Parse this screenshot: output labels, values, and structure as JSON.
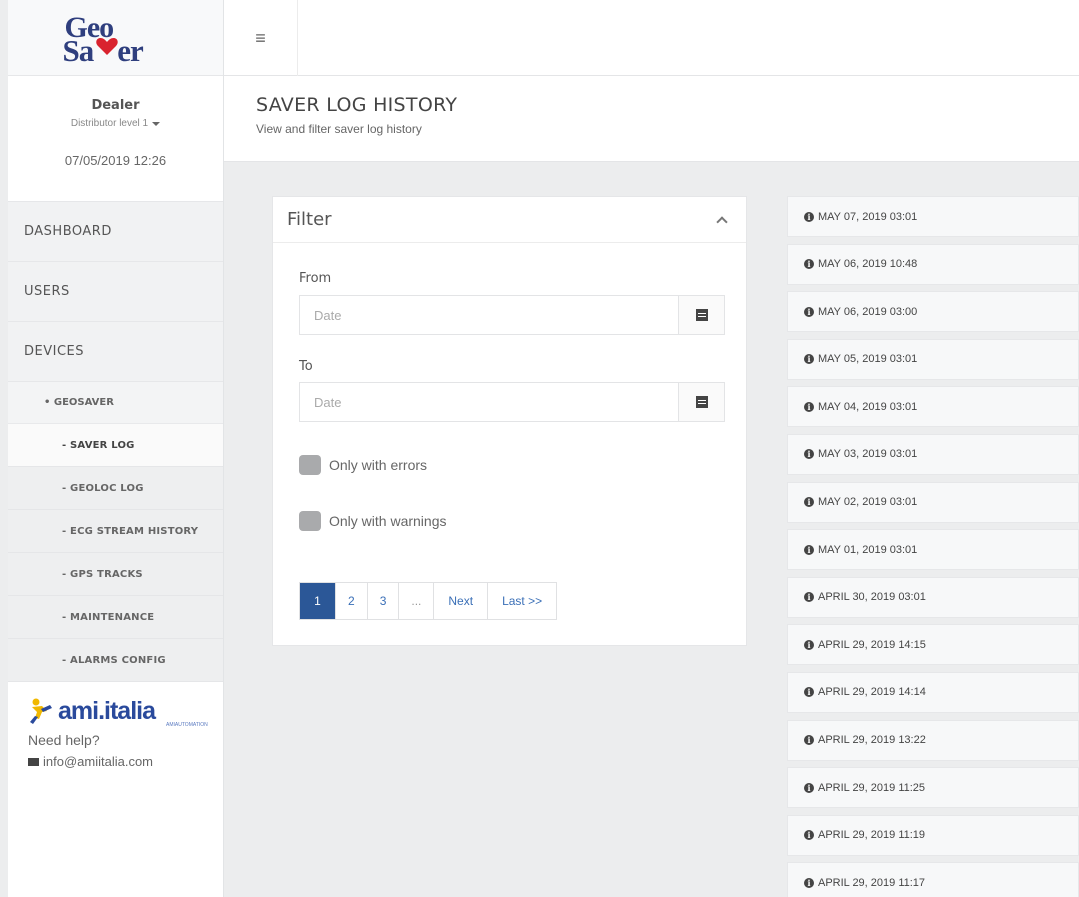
{
  "brand": {
    "line1": "Geo",
    "line2_left": "Sa",
    "line2_right": "er"
  },
  "user": {
    "name": "Dealer",
    "role": "Distributor level 1",
    "datetime": "07/05/2019 12:26"
  },
  "menu": {
    "dashboard": "DASHBOARD",
    "users": "USERS",
    "devices": "DEVICES",
    "geosaver": "• GEOSAVER",
    "saver_log": "- SAVER LOG",
    "geoloc_log": "- GEOLOC LOG",
    "ecg_stream": "- ECG STREAM HISTORY",
    "gps_tracks": "- GPS TRACKS",
    "maintenance": "- MAINTENANCE",
    "alarms_config": "- ALARMS CONFIG"
  },
  "help": {
    "company": "ami.italia",
    "company_tag": "AMIAUTOMATION",
    "need_help": "Need help?",
    "email": "info@amiitalia.com"
  },
  "header": {
    "title": "SAVER LOG HISTORY",
    "subtitle": "View and filter saver log history"
  },
  "filter": {
    "title": "Filter",
    "from_label": "From",
    "to_label": "To",
    "date_placeholder": "Date",
    "only_errors": "Only with errors",
    "only_warnings": "Only with warnings"
  },
  "pagination": {
    "p1": "1",
    "p2": "2",
    "p3": "3",
    "ellipsis": "...",
    "next": "Next",
    "last": "Last >>"
  },
  "logs": [
    "MAY 07, 2019 03:01",
    "MAY 06, 2019 10:48",
    "MAY 06, 2019 03:00",
    "MAY 05, 2019 03:01",
    "MAY 04, 2019 03:01",
    "MAY 03, 2019 03:01",
    "MAY 02, 2019 03:01",
    "MAY 01, 2019 03:01",
    "APRIL 30, 2019 03:01",
    "APRIL 29, 2019 14:15",
    "APRIL 29, 2019 14:14",
    "APRIL 29, 2019 13:22",
    "APRIL 29, 2019 11:25",
    "APRIL 29, 2019 11:19",
    "APRIL 29, 2019 11:17"
  ],
  "colors": {
    "brand_blue": "#2f3f7e",
    "heart_red": "#d9232e",
    "pager_active": "#2b5797",
    "link_blue": "#3a6fb7"
  }
}
